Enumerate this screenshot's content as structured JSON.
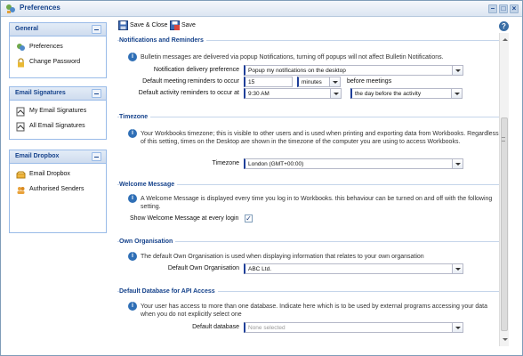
{
  "window": {
    "title": "Preferences",
    "controls": {
      "minimize": "–",
      "maximize": "□",
      "close": "×"
    }
  },
  "sidebar": {
    "panels": [
      {
        "title": "General",
        "items": [
          {
            "label": "Preferences",
            "icon": "preferences-icon"
          },
          {
            "label": "Change Password",
            "icon": "lock-icon"
          }
        ]
      },
      {
        "title": "Email Signatures",
        "items": [
          {
            "label": "My Email Signatures",
            "icon": "signature-icon"
          },
          {
            "label": "All Email Signatures",
            "icon": "signature-icon"
          }
        ]
      },
      {
        "title": "Email Dropbox",
        "items": [
          {
            "label": "Email Dropbox",
            "icon": "dropbox-icon"
          },
          {
            "label": "Authorised Senders",
            "icon": "users-icon"
          }
        ]
      }
    ]
  },
  "toolbar": {
    "save_close_label": "Save & Close",
    "save_label": "Save"
  },
  "sections": {
    "notifications": {
      "title": "Notifications and Reminders",
      "info": "Bulletin messages are delivered via popup Notifications, turning off popups will not affect Bulletin Notifications.",
      "delivery_label": "Notification delivery preference",
      "delivery_value": "Popup my notifications on the desktop",
      "meeting_label": "Default meeting reminders to occur",
      "meeting_value": "15",
      "meeting_unit": "minutes",
      "meeting_suffix": "before meetings",
      "activity_label": "Default activity reminders to occur at",
      "activity_time": "9:30 AM",
      "activity_when": "the day before the activity"
    },
    "timezone": {
      "title": "Timezone",
      "info": "Your Workbooks timezone; this is visible to other users and is used when printing and exporting data from Workbooks. Regardless of this setting, times on the Desktop are shown in the timezone of the computer you are using to access Workbooks.",
      "label": "Timezone",
      "value": "London (GMT+00:00)"
    },
    "welcome": {
      "title": "Welcome Message",
      "info": "A Welcome Message is displayed every time you log in to Workbooks. this behaviour can be turned on and off with the following setting.",
      "label": "Show Welcome Message at every login",
      "checked": "✓"
    },
    "organisation": {
      "title": "Own Organisation",
      "info": "The default Own Organisation is used when displaying information that relates to your own organsation",
      "label": "Default Own Organisation",
      "value": "ABC Ltd."
    },
    "api": {
      "title": "Default Database for API Access",
      "info": "Your user has access to more than one database. Indicate here which is to be used by external programs accessing your data when you do not explicitly select one",
      "label": "Default database",
      "placeholder": "None selected"
    }
  },
  "colors": {
    "accent": "#15428b",
    "panel_border": "#99bbe8",
    "info_icon": "#2f6fb6"
  }
}
